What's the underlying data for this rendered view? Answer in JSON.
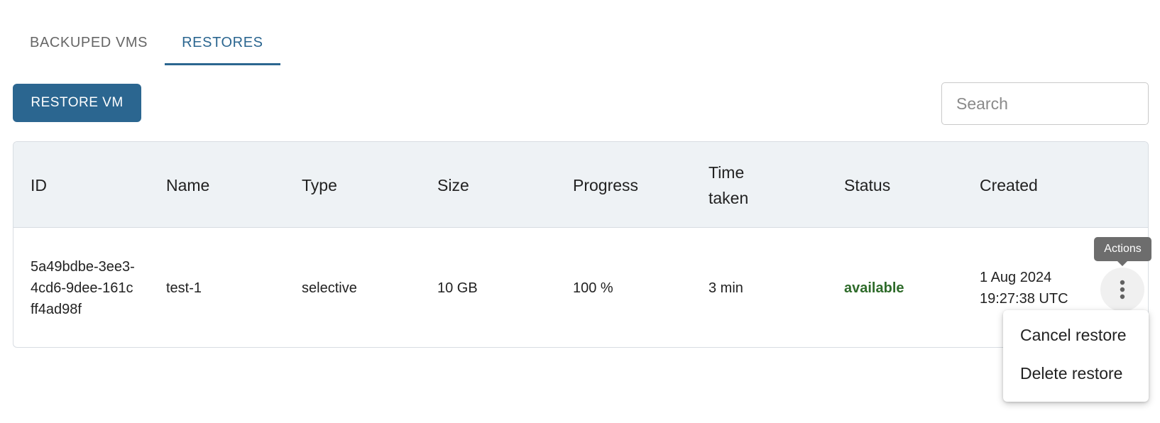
{
  "tabs": [
    {
      "label": "BACKUPED VMS",
      "active": false
    },
    {
      "label": "RESTORES",
      "active": true
    }
  ],
  "toolbar": {
    "restore_button": "RESTORE VM",
    "search_placeholder": "Search"
  },
  "table": {
    "headers": {
      "id": "ID",
      "name": "Name",
      "type": "Type",
      "size": "Size",
      "progress": "Progress",
      "time_taken": "Time taken",
      "status": "Status",
      "created": "Created"
    },
    "rows": [
      {
        "id": "5a49bdbe-3ee3-4cd6-9dee-161cff4ad98f",
        "name": "test-1",
        "type": "selective",
        "size": "10 GB",
        "progress": "100 %",
        "time_taken": "3 min",
        "status": "available",
        "created": "1 Aug 2024 19:27:38 UTC"
      }
    ]
  },
  "row_actions": {
    "tooltip": "Actions",
    "icon": "more-vert-icon",
    "menu": [
      "Cancel restore",
      "Delete restore"
    ]
  },
  "colors": {
    "accent": "#2b6690",
    "header_bg": "#eef2f5",
    "status_available": "#2e6b2a",
    "tooltip_bg": "#6d6d6d"
  }
}
